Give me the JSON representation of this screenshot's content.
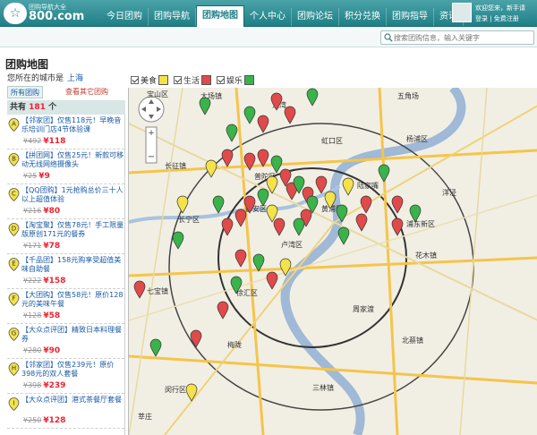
{
  "site": {
    "logo_text": "800.com",
    "logo_mark": "☆",
    "slogan": "团购导航大全"
  },
  "nav": [
    {
      "label": "今日团购"
    },
    {
      "label": "团购导航"
    },
    {
      "label": "团购地图",
      "active": true
    },
    {
      "label": "个人中心"
    },
    {
      "label": "团购论坛"
    },
    {
      "label": "积分兑换"
    },
    {
      "label": "团购指导"
    },
    {
      "label": "资讯"
    }
  ],
  "user": {
    "line1": "欢迎您来，新手请",
    "line2": "登录 | 免费注册"
  },
  "search": {
    "placeholder": "搜索团购信息，输入关键字"
  },
  "page": {
    "title": "团购地图",
    "city_label": "您所在的城市是",
    "city": "上海",
    "tab_all": "所有团购",
    "tab_other": "查看其它团购",
    "count_prefix": "共有",
    "count": "181",
    "count_suffix": "个"
  },
  "filters": [
    {
      "label": "美食",
      "color": "#f3e24a"
    },
    {
      "label": "生活",
      "color": "#e04a4a"
    },
    {
      "label": "娱乐",
      "color": "#3ab34a"
    }
  ],
  "deals": [
    {
      "letter": "A",
      "title": "【邻家团】仅售118元！早晚音乐培训门店4节体验课",
      "old_price": "¥492",
      "new_price": "¥118",
      "color": "#f3e24a"
    },
    {
      "letter": "B",
      "title": "【拼团网】仅售25元！新款可移动无线网络摄像头",
      "old_price": "¥25",
      "new_price": "¥9",
      "color": "#f3e24a"
    },
    {
      "letter": "C",
      "title": "【QQ团购】1元抢购总价三十人以上超值体验",
      "old_price": "¥216",
      "new_price": "¥80",
      "color": "#f3e24a"
    },
    {
      "letter": "D",
      "title": "【淘宝聚】仅售78元！手工限量版原创171元的餐券",
      "old_price": "¥171",
      "new_price": "¥78",
      "color": "#f3e24a"
    },
    {
      "letter": "E",
      "title": "【千品团】158元购享受超值美味自助餐",
      "old_price": "¥222",
      "new_price": "¥158",
      "color": "#f3e24a"
    },
    {
      "letter": "F",
      "title": "【大团购】仅售58元！原价128元的美味午餐",
      "old_price": "¥128",
      "new_price": "¥58",
      "color": "#f3e24a"
    },
    {
      "letter": "G",
      "title": "【大众点评团】精致日本料理餐券",
      "old_price": "¥280",
      "new_price": "¥90",
      "color": "#f3e24a"
    },
    {
      "letter": "H",
      "title": "【邻家团】仅售239元！原价398元的双人套餐",
      "old_price": "¥398",
      "new_price": "¥239",
      "color": "#f3e24a"
    },
    {
      "letter": "I",
      "title": "【大众点评团】港式茶餐厅套餐",
      "old_price": "¥250",
      "new_price": "¥128",
      "color": "#f3e24a"
    }
  ],
  "map": {
    "labels": [
      "大场镇",
      "宝山区",
      "五角场",
      "虹口区",
      "杨浦区",
      "江湾",
      "普陀区",
      "长征镇",
      "静安区",
      "黄浦区",
      "卢湾区",
      "徐汇区",
      "长宁区",
      "浦东新区",
      "花木镇",
      "三林镇",
      "闵行区",
      "莘庄",
      "七宝镇",
      "梅陇",
      "北蔡镇",
      "陆家嘴",
      "洋泾",
      "周家渡"
    ],
    "pins": [
      {
        "c": "#3ab34a"
      },
      {
        "c": "#3ab34a"
      },
      {
        "c": "#e04a4a"
      },
      {
        "c": "#e04a4a"
      },
      {
        "c": "#3ab34a"
      },
      {
        "c": "#e04a4a"
      },
      {
        "c": "#3ab34a"
      },
      {
        "c": "#e04a4a"
      },
      {
        "c": "#f3e24a"
      },
      {
        "c": "#e04a4a"
      },
      {
        "c": "#e04a4a"
      },
      {
        "c": "#3ab34a"
      },
      {
        "c": "#e04a4a"
      },
      {
        "c": "#e04a4a"
      },
      {
        "c": "#f3e24a"
      },
      {
        "c": "#3ab34a"
      },
      {
        "c": "#e04a4a"
      },
      {
        "c": "#3ab34a"
      },
      {
        "c": "#e04a4a"
      },
      {
        "c": "#f3e24a"
      },
      {
        "c": "#3ab34a"
      },
      {
        "c": "#e04a4a"
      },
      {
        "c": "#3ab34a"
      },
      {
        "c": "#e04a4a"
      },
      {
        "c": "#f3e24a"
      },
      {
        "c": "#e04a4a"
      },
      {
        "c": "#3ab34a"
      },
      {
        "c": "#e04a4a"
      },
      {
        "c": "#e04a4a"
      },
      {
        "c": "#3ab34a"
      },
      {
        "c": "#f3e24a"
      },
      {
        "c": "#e04a4a"
      },
      {
        "c": "#3ab34a"
      },
      {
        "c": "#e04a4a"
      },
      {
        "c": "#e04a4a"
      },
      {
        "c": "#3ab34a"
      },
      {
        "c": "#e04a4a"
      },
      {
        "c": "#3ab34a"
      },
      {
        "c": "#f3e24a"
      },
      {
        "c": "#e04a4a"
      },
      {
        "c": "#3ab34a"
      },
      {
        "c": "#e04a4a"
      },
      {
        "c": "#3ab34a"
      },
      {
        "c": "#e04a4a"
      },
      {
        "c": "#f3e24a"
      },
      {
        "c": "#3ab34a"
      },
      {
        "c": "#e04a4a"
      },
      {
        "c": "#3ab34a"
      },
      {
        "c": "#e04a4a"
      },
      {
        "c": "#f3e24a"
      }
    ]
  }
}
